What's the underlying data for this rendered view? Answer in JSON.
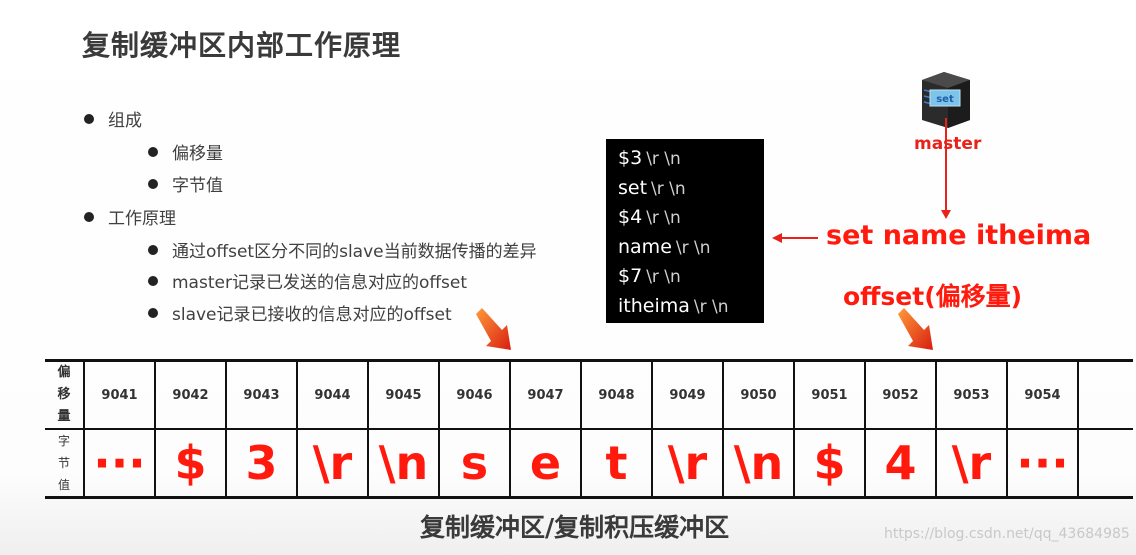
{
  "slide": {
    "title": "复制缓冲区内部工作原理",
    "caption": "复制缓冲区/复制积压缓冲区",
    "watermark": "https://blog.csdn.net/qq_43684985"
  },
  "bullets": [
    {
      "level": 1,
      "text": "组成"
    },
    {
      "level": 2,
      "text": "偏移量"
    },
    {
      "level": 2,
      "text": "字节值"
    },
    {
      "level": 1,
      "text": "工作原理"
    },
    {
      "level": 2,
      "text": "通过offset区分不同的slave当前数据传播的差异"
    },
    {
      "level": 2,
      "text": "master记录已发送的信息对应的offset"
    },
    {
      "level": 2,
      "text": "slave记录已接收的信息对应的offset"
    }
  ],
  "protocol": [
    {
      "token": "$3",
      "suffix": "\\r \\n"
    },
    {
      "token": "set",
      "suffix": "\\r \\n"
    },
    {
      "token": "$4",
      "suffix": "\\r \\n"
    },
    {
      "token": "name",
      "suffix": "\\r \\n"
    },
    {
      "token": "$7",
      "suffix": "\\r \\n"
    },
    {
      "token": "itheima",
      "suffix": "\\r \\n"
    }
  ],
  "master": {
    "screen_label": "set",
    "label": "master",
    "command": "set name itheima",
    "offset_label": "offset(偏移量)"
  },
  "buffer": {
    "offset_header": [
      "偏",
      "移",
      "量"
    ],
    "byte_header": [
      "字",
      "节",
      "值"
    ],
    "offsets": [
      "9041",
      "9042",
      "9043",
      "9044",
      "9045",
      "9046",
      "9047",
      "9048",
      "9049",
      "9050",
      "9051",
      "9052",
      "9053",
      "9054",
      ""
    ],
    "bytes": [
      "···",
      "$",
      "3",
      "\\r",
      "\\n",
      "s",
      "e",
      "t",
      "\\r",
      "\\n",
      "$",
      "4",
      "\\r",
      "···",
      ""
    ]
  },
  "colors": {
    "accent_red": "#ff1a0d",
    "text_dark": "#3a3a3a",
    "server_screen": "#7ec3ea"
  }
}
